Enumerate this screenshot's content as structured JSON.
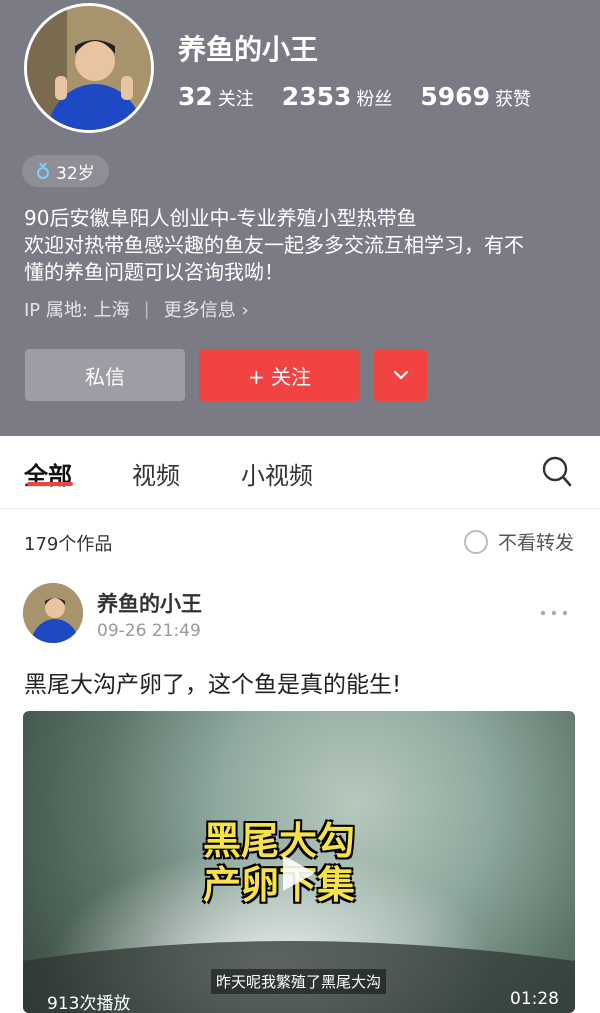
{
  "profile": {
    "nickname": "养鱼的小王",
    "stats": [
      {
        "num": "32",
        "label": "关注"
      },
      {
        "num": "2353",
        "label": "粉丝"
      },
      {
        "num": "5969",
        "label": "获赞"
      }
    ],
    "age_tag": "32岁",
    "bio_lines": [
      "90后安徽阜阳人创业中-专业养殖小型热带鱼",
      "欢迎对热带鱼感兴趣的鱼友一起多多交流互相学习，有不",
      "懂的养鱼问题可以咨询我呦！"
    ],
    "ip_location": "IP 属地: 上海",
    "more_info": "更多信息 ›",
    "buttons": {
      "message": "私信",
      "follow": "+ 关注"
    }
  },
  "tabs": [
    "全部",
    "视频",
    "小视频"
  ],
  "works": {
    "count_label": "179个作品",
    "no_repost_label": "不看转发"
  },
  "post": {
    "author": "养鱼的小王",
    "time": "09-26 21:49",
    "text": "黑尾大沟产卵了，这个鱼是真的能生!",
    "video": {
      "title_line1": "黑尾大勾",
      "title_line2": "产卵下集",
      "subtitle": "昨天呢我繁殖了黑尾大沟",
      "views": "913次播放",
      "duration": "01:28"
    }
  },
  "colors": {
    "accent": "#f04342",
    "header_bg": "#7b7b85"
  }
}
